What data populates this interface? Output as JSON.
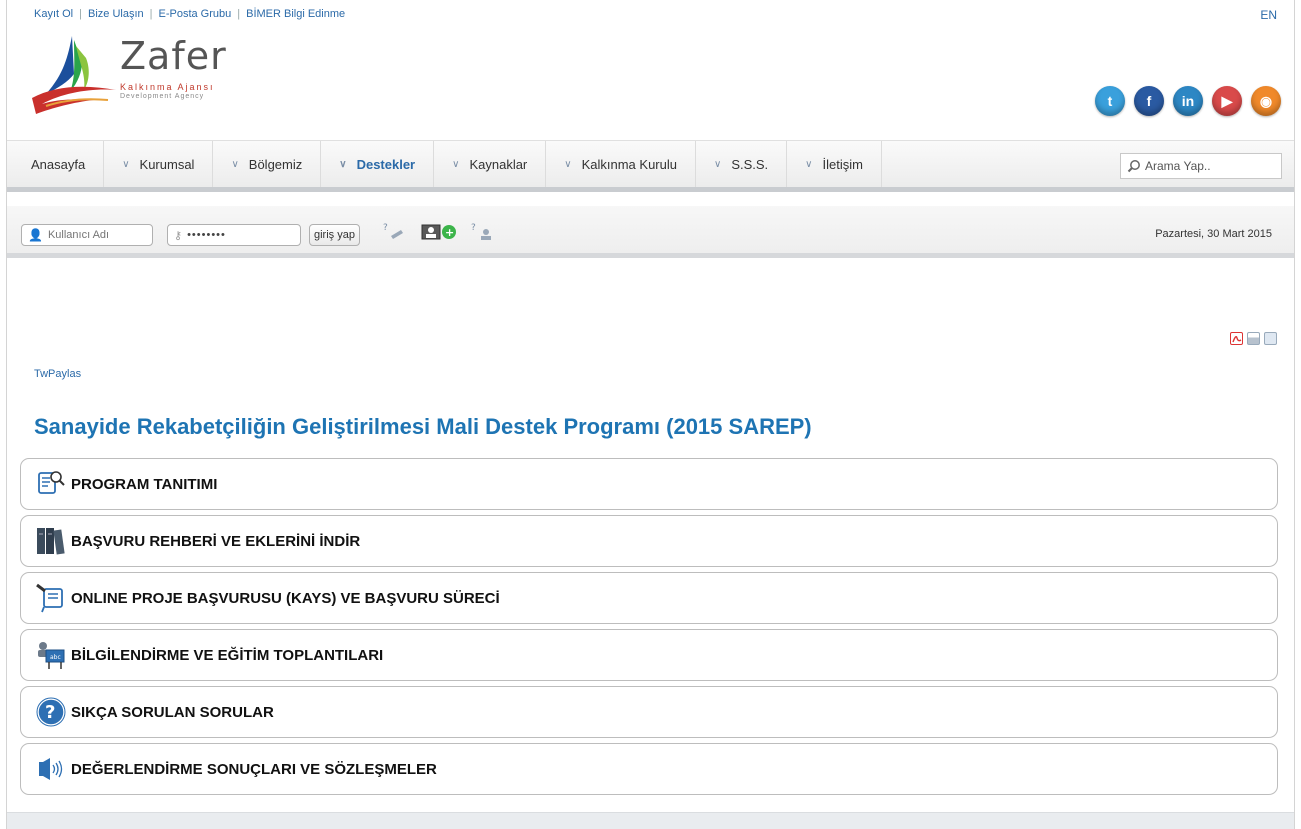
{
  "top_links": [
    "Kayıt Ol",
    "Bize Ulaşın",
    "E-Posta Grubu",
    "BİMER Bilgi Edinme"
  ],
  "language_link": "EN",
  "logo": {
    "title": "Zafer",
    "subtitle": "Kalkınma Ajansı",
    "subtitle2": "Development Agency"
  },
  "social": [
    {
      "name": "twitter-icon",
      "color": "#3aa0dc",
      "glyph": "t"
    },
    {
      "name": "facebook-icon",
      "color": "#2a5aa2",
      "glyph": "f"
    },
    {
      "name": "linkedin-icon",
      "color": "#2d87c4",
      "glyph": "in"
    },
    {
      "name": "youtube-icon",
      "color": "#d94a4a",
      "glyph": "▶"
    },
    {
      "name": "rss-icon",
      "color": "#f0892a",
      "glyph": "◉"
    }
  ],
  "nav": {
    "items": [
      {
        "label": "Anasayfa",
        "dropdown": false
      },
      {
        "label": "Kurumsal",
        "dropdown": true
      },
      {
        "label": "Bölgemiz",
        "dropdown": true
      },
      {
        "label": "Destekler",
        "dropdown": true,
        "active": true
      },
      {
        "label": "Kaynaklar",
        "dropdown": true
      },
      {
        "label": "Kalkınma Kurulu",
        "dropdown": true
      },
      {
        "label": "S.S.S.",
        "dropdown": true
      },
      {
        "label": "İletişim",
        "dropdown": true
      }
    ],
    "search_placeholder": "Arama Yap.."
  },
  "login": {
    "username_placeholder": "Kullanıcı Adı",
    "password_value": "••••••••",
    "login_button": "giriş yap",
    "date": "Pazartesi, 30 Mart 2015"
  },
  "breadcrumb": "TwPaylas",
  "page_title": "Sanayide Rekabetçiliğin Geliştirilmesi Mali Destek Programı (2015 SAREP)",
  "sections": [
    {
      "label": "PROGRAM TANITIMI",
      "icon": "document-search-icon"
    },
    {
      "label": "BAŞVURU REHBERİ VE EKLERİNİ İNDİR",
      "icon": "binders-icon"
    },
    {
      "label": "ONLINE PROJE BAŞVURUSU (KAYS) VE BAŞVURU SÜRECİ",
      "icon": "form-pen-icon"
    },
    {
      "label": "BİLGİLENDİRME VE EĞİTİM TOPLANTILARI",
      "icon": "training-board-icon"
    },
    {
      "label": "SIKÇA SORULAN SORULAR",
      "icon": "question-icon"
    },
    {
      "label": "DEĞERLENDİRME SONUÇLARI VE SÖZLEŞMELER",
      "icon": "speaker-icon"
    }
  ]
}
